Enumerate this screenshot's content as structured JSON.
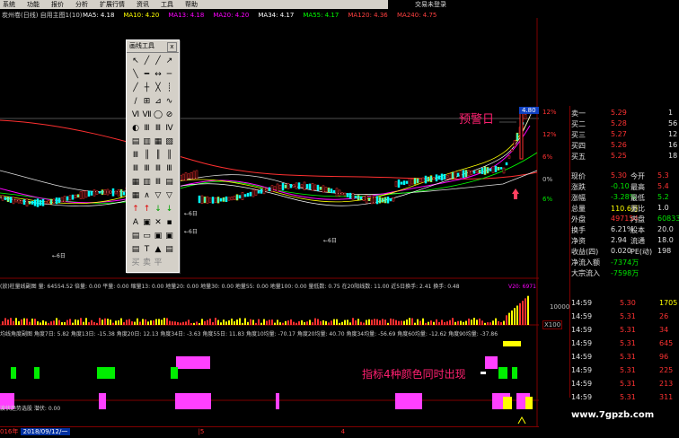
{
  "menu": [
    "系统",
    "功能",
    "报价",
    "分析",
    "扩展行情",
    "资讯",
    "工具",
    "帮助"
  ],
  "top_right_text": "交易未登录",
  "header": {
    "title": "炭州卷(日线) 自用主图1(10)",
    "ma_items": [
      {
        "label": "MA5: 4.18",
        "color": "#ffffff"
      },
      {
        "label": "MA10: 4.20",
        "color": "#ffff00"
      },
      {
        "label": "MA13: 4.18",
        "color": "#ff00ff"
      },
      {
        "label": "MA20: 4.20",
        "color": "#ff00ff"
      },
      {
        "label": "MA34: 4.17",
        "color": "#ffffff"
      },
      {
        "label": "MA55: 4.17",
        "color": "#00ff00"
      },
      {
        "label": "MA120: 4.36",
        "color": "#ff4040"
      },
      {
        "label": "MA240: 4.75",
        "color": "#ff4040"
      }
    ]
  },
  "toolbox": {
    "title": "画线工具",
    "close": "x",
    "tools": [
      "↖",
      "╱",
      "╱",
      "↗",
      "╲",
      "━",
      "↔",
      "─",
      "╱",
      "┼",
      "╳",
      "┊",
      "∕",
      "⊞",
      "⊿",
      "∿",
      "Ⅵ",
      "Ⅶ",
      "◯",
      "⊘",
      "◐",
      "Ⅲ",
      "Ⅲ",
      "Ⅳ",
      "▤",
      "▥",
      "▦",
      "▧",
      "Ⅲ",
      "║",
      "║",
      "║",
      "Ⅲ",
      "Ⅲ",
      "Ⅲ",
      "Ⅲ",
      "▦",
      "▥",
      "Ⅲ",
      "▤",
      "▦",
      "∧",
      "▽",
      "▽",
      "↑",
      "↑",
      "↓",
      "↓",
      "A",
      "▣",
      "✕",
      "▪",
      "▤",
      "▭",
      "▣",
      "▣",
      "▤",
      "T",
      "▲",
      "▤",
      "买",
      "卖",
      "平"
    ]
  },
  "annotations": {
    "warning_day": "预警日",
    "signal_text": "指标4种颜色同时出现",
    "day_labels": [
      "←6日",
      "←6日",
      "←6日",
      "←6日"
    ],
    "price_axis_label": "4.80"
  },
  "volume_header": "(放)柱量线副图  量: 64554.52  倍量: 0.00  平量: 0.00  缩量13: 0.00  地量20: 0.00  地量30: 0.00  地量55: 0.00  地量100: 0.00  量低数: 0.75  在20阳线数: 11.00  近5日换手: 2.41  换手: 0.48",
  "volume_right": "V20: 6971",
  "volume_axis": "10000",
  "volume_unit": "X100",
  "angle_header": "均线角度副图  角度7日: 5.82  角度13日: -15.38  角度20日: 12.13  角度34日: -3.63  角度55日: 11.83  角度10均量: -70.17  角度20均量: 40.70  角度34均量: -56.69  角度60均量: -12.62  角度90均量: -37.86",
  "pct_axis": [
    "12%",
    "6%",
    "0%",
    "6%"
  ],
  "trend_header": "波伏趋势选股  潜伏: 0.00",
  "status_bar": [
    "016年",
    "2018/09/12/一",
    "|5",
    "4"
  ],
  "order_book": {
    "sell": [
      {
        "label": "卖一",
        "price": "5.29",
        "vol": "1"
      },
      {
        "label": "买二",
        "price": "5.28",
        "vol": "56"
      },
      {
        "label": "买三",
        "price": "5.27",
        "vol": "12"
      },
      {
        "label": "买四",
        "price": "5.26",
        "vol": "16"
      },
      {
        "label": "买五",
        "price": "5.25",
        "vol": "18"
      }
    ]
  },
  "quote": [
    {
      "k1": "现价",
      "v1": "5.30",
      "k2": "今开",
      "v2": "5.3",
      "c1": "red",
      "c2": "red"
    },
    {
      "k1": "涨跌",
      "v1": "-0.10",
      "k2": "最高",
      "v2": "5.4",
      "c1": "green",
      "c2": "red"
    },
    {
      "k1": "涨幅",
      "v1": "-3.28%",
      "k2": "最低",
      "v2": "5.2",
      "c1": "green",
      "c2": "green"
    },
    {
      "k1": "总量",
      "v1": "110.6万",
      "k2": "量比",
      "v2": "1.0",
      "c1": "yellow",
      "c2": "white"
    },
    {
      "k1": "外盘",
      "v1": "497154",
      "k2": "内盘",
      "v2": "60833",
      "c1": "red",
      "c2": "green"
    },
    {
      "k1": "换手",
      "v1": "6.21%",
      "k2": "股本",
      "v2": "20.0",
      "c1": "white",
      "c2": "white"
    },
    {
      "k1": "净资",
      "v1": "2.94",
      "k2": "流通",
      "v2": "18.0",
      "c1": "white",
      "c2": "white"
    },
    {
      "k1": "收益(四)",
      "v1": "0.020",
      "k2": "PE(动)",
      "v2": "198",
      "c1": "white",
      "c2": "white"
    },
    {
      "k1": "净流入额",
      "v1": "-7374万",
      "k2": "",
      "v2": "",
      "c1": "green",
      "c2": "white"
    },
    {
      "k1": "大宗流入",
      "v1": "-7598万",
      "k2": "",
      "v2": "",
      "c1": "green",
      "c2": "white"
    }
  ],
  "ticks": [
    {
      "time": "14:59",
      "price": "5.30",
      "vol": "1705",
      "c": "yellow"
    },
    {
      "time": "14:59",
      "price": "5.31",
      "vol": "26",
      "c": "red"
    },
    {
      "time": "14:59",
      "price": "5.31",
      "vol": "34",
      "c": "red"
    },
    {
      "time": "14:59",
      "price": "5.31",
      "vol": "645",
      "c": "red"
    },
    {
      "time": "14:59",
      "price": "5.31",
      "vol": "96",
      "c": "red"
    },
    {
      "time": "14:59",
      "price": "5.31",
      "vol": "225",
      "c": "red"
    },
    {
      "time": "14:59",
      "price": "5.31",
      "vol": "213",
      "c": "red"
    },
    {
      "time": "14:59",
      "price": "5.31",
      "vol": "311",
      "c": "red"
    }
  ],
  "watermark": "www.7gpzb.com"
}
